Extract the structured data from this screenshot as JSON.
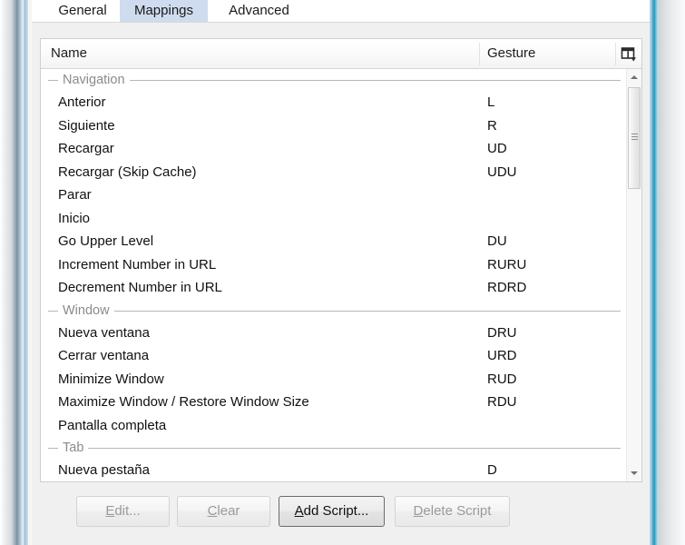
{
  "window": {
    "theme_accent": "#3ea8c9",
    "client_background": "#f0f0f0"
  },
  "tabs": [
    {
      "label": "General",
      "selected": false
    },
    {
      "label": "Mappings",
      "selected": true
    },
    {
      "label": "Advanced",
      "selected": false
    }
  ],
  "list": {
    "columns": [
      {
        "key": "name",
        "label": "Name"
      },
      {
        "key": "gesture",
        "label": "Gesture"
      }
    ],
    "column_chooser_icon": "table-columns-icon",
    "selected_tab_highlight": "#cfdcef",
    "rows": [
      {
        "type": "group",
        "label": "Navigation"
      },
      {
        "type": "item",
        "name": "Anterior",
        "gesture": "L"
      },
      {
        "type": "item",
        "name": "Siguiente",
        "gesture": "R"
      },
      {
        "type": "item",
        "name": "Recargar",
        "gesture": "UD"
      },
      {
        "type": "item",
        "name": "Recargar (Skip Cache)",
        "gesture": "UDU"
      },
      {
        "type": "item",
        "name": "Parar",
        "gesture": ""
      },
      {
        "type": "item",
        "name": "Inicio",
        "gesture": ""
      },
      {
        "type": "item",
        "name": "Go Upper Level",
        "gesture": "DU"
      },
      {
        "type": "item",
        "name": "Increment Number in URL",
        "gesture": "RURU"
      },
      {
        "type": "item",
        "name": "Decrement Number in URL",
        "gesture": "RDRD"
      },
      {
        "type": "group",
        "label": "Window"
      },
      {
        "type": "item",
        "name": "Nueva ventana",
        "gesture": "DRU"
      },
      {
        "type": "item",
        "name": "Cerrar ventana",
        "gesture": "URD"
      },
      {
        "type": "item",
        "name": "Minimize Window",
        "gesture": "RUD"
      },
      {
        "type": "item",
        "name": "Maximize Window / Restore Window Size",
        "gesture": "RDU"
      },
      {
        "type": "item",
        "name": "Pantalla completa",
        "gesture": ""
      },
      {
        "type": "group",
        "label": "Tab"
      },
      {
        "type": "item",
        "name": "Nueva pestaña",
        "gesture": "D"
      }
    ]
  },
  "scrollbar": {
    "up_icon": "scroll-up-arrow-icon",
    "down_icon": "scroll-down-arrow-icon",
    "thumb_position_pct": 0,
    "thumb_size_pct": 25
  },
  "buttons": [
    {
      "id": "edit",
      "label": "Edit...",
      "mnemonic": "E",
      "rest": "dit...",
      "enabled": false
    },
    {
      "id": "clear",
      "label": "Clear",
      "mnemonic": "C",
      "rest": "lear",
      "enabled": false
    },
    {
      "id": "add_script",
      "label": "Add Script...",
      "mnemonic": "A",
      "rest": "dd Script...",
      "enabled": true
    },
    {
      "id": "delete_script",
      "label": "Delete Script",
      "mnemonic": "D",
      "rest": "elete Script",
      "enabled": false
    }
  ]
}
